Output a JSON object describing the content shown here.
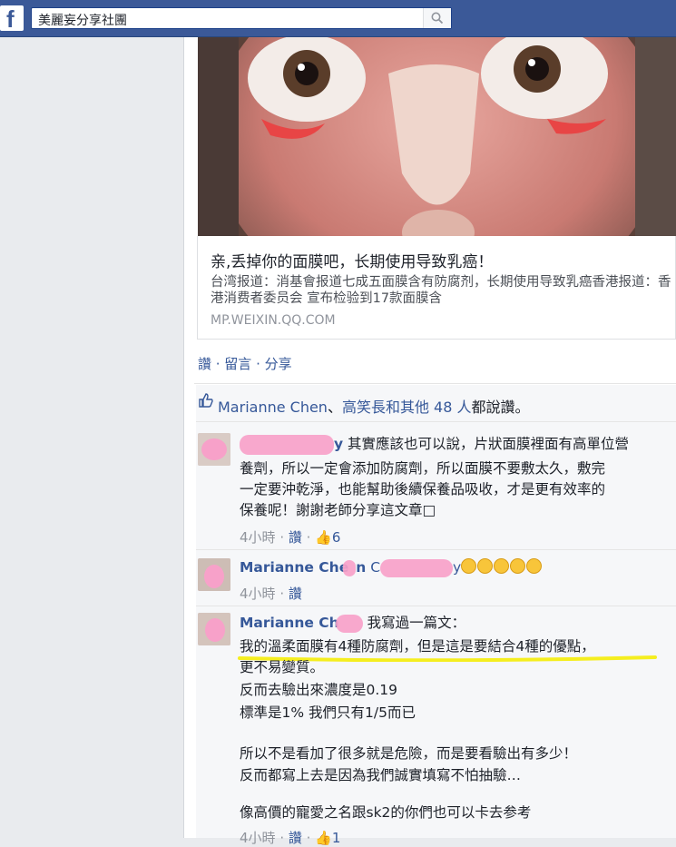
{
  "header": {
    "logo": "f",
    "search_value": "美麗妄分享社團",
    "search_icon": "search-icon"
  },
  "link": {
    "title": "亲,丢掉你的面膜吧，长期使用导致乳癌！",
    "desc": "台湾报道：消基會报道七成五面膜含有防腐剂，长期使用导致乳癌香港报道：香港消费者委员会 宣布检验到17款面膜含",
    "source": "MP.WEIXIN.QQ.COM"
  },
  "actions": {
    "text": "讚 · 留言 · 分享"
  },
  "likes": {
    "name1": "Marianne Chen",
    "sep": "、",
    "name2": "高笑長和其他 48 人",
    "suffix": "都說讚。"
  },
  "comments": [
    {
      "name_tail": "y",
      "lines": [
        "其實應該也可以說，片狀面膜裡面有高單位營",
        "養劑，所以一定會添加防腐劑，所以面膜不要敷太久，敷完",
        "一定要沖乾淨，也能幫助後續保養品吸收，才是更有效率的",
        "保養呢！謝謝老師分享這文章□"
      ],
      "time": "4小時",
      "like": "讚",
      "like_count": "6"
    },
    {
      "name": "Marianne Che",
      "name_tail": "n",
      "tag_start": "C",
      "tag_tail": "y",
      "time": "4小時",
      "like": "讚"
    },
    {
      "name": "Marianne Ch",
      "intro": "我寫過一篇文：",
      "lines": [
        "我的溫柔面膜有4種防腐劑，但是這是要結合4種的優點，",
        "更不易變質。",
        "反而去驗出來濃度是0.19",
        "標準是1% 我們只有1/5而已",
        "",
        "所以不是看加了很多就是危險，而是要看驗出有多少！",
        "反而都寫上去是因為我們誠實填寫不怕抽驗…",
        "",
        "像高價的寵愛之名跟sk2的你們也可以卡去参考"
      ],
      "time": "4小時",
      "like": "讚",
      "like_count": "1"
    }
  ],
  "colors": {
    "brand": "#3b5998",
    "link": "#365899",
    "highlight": "#f5ee1f",
    "redact": "#f7a1c9"
  }
}
